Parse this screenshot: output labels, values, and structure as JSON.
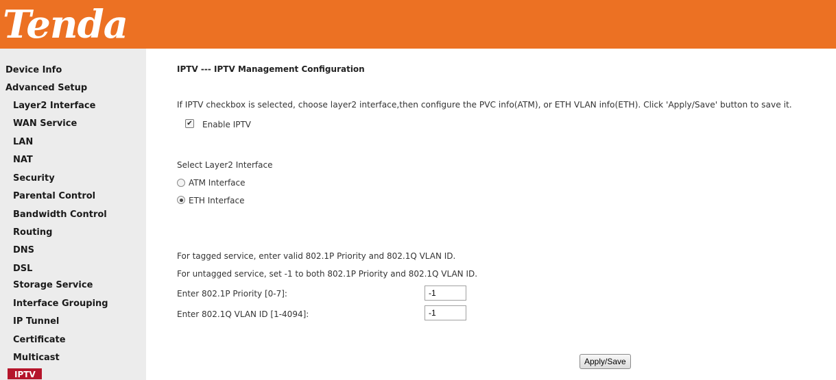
{
  "header": {
    "logo": "Tenda"
  },
  "sidebar": {
    "items": [
      {
        "label": "Device Info"
      },
      {
        "label": "Advanced Setup"
      },
      {
        "label": "Layer2 Interface"
      },
      {
        "label": "WAN Service"
      },
      {
        "label": "LAN"
      },
      {
        "label": "NAT"
      },
      {
        "label": "Security"
      },
      {
        "label": "Parental Control"
      },
      {
        "label": "Bandwidth Control"
      },
      {
        "label": "Routing"
      },
      {
        "label": "DNS"
      },
      {
        "label": "DSL"
      },
      {
        "label": "Storage Service"
      },
      {
        "label": "Interface Grouping"
      },
      {
        "label": "IP Tunnel"
      },
      {
        "label": "Certificate"
      },
      {
        "label": "Multicast"
      },
      {
        "label": "IPTV"
      }
    ],
    "active_index": 17,
    "active_color": "#b5152b"
  },
  "main": {
    "title": "IPTV --- IPTV Management Configuration",
    "description": "If IPTV checkbox is selected, choose layer2 interface,then configure the PVC info(ATM), or ETH VLAN info(ETH). Click 'Apply/Save' button to save it.",
    "enable_iptv": {
      "label": "Enable IPTV",
      "checked": true
    },
    "layer2": {
      "heading": "Select Layer2 Interface",
      "options": [
        {
          "label": "ATM Interface",
          "checked": false
        },
        {
          "label": "ETH Interface",
          "checked": true
        }
      ]
    },
    "vlan": {
      "tagged_note": "For tagged service, enter valid 802.1P Priority and 802.1Q VLAN ID.",
      "untagged_note": "For untagged service, set -1 to both 802.1P Priority and 802.1Q VLAN ID.",
      "priority_label": "Enter 802.1P Priority [0-7]:",
      "priority_value": "-1",
      "vlan_id_label": "Enter 802.1Q VLAN ID [1-4094]:",
      "vlan_id_value": "-1"
    },
    "apply_button": "Apply/Save"
  },
  "colors": {
    "header": "#ec7123",
    "sidebar": "#ececec"
  }
}
